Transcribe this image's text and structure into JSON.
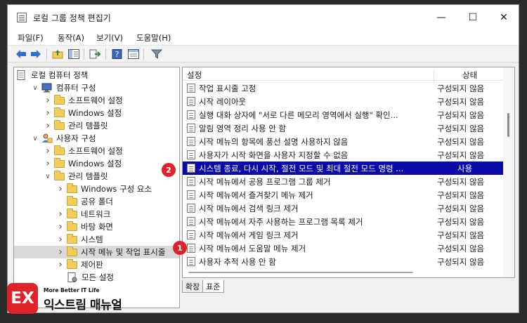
{
  "window": {
    "title": "로컬 그룹 정책 편집기",
    "minimize_glyph": "—",
    "maximize_glyph": "☐",
    "close_glyph": "✕"
  },
  "menubar": [
    "파일(F)",
    "동작(A)",
    "보기(V)",
    "도움말(H)"
  ],
  "toolbar": {
    "icons": [
      "back-arrow-icon",
      "forward-arrow-icon",
      "up-folder-icon",
      "show-hide-tree-icon",
      "export-list-icon",
      "help-icon",
      "properties-icon",
      "filter-icon"
    ]
  },
  "tree": [
    {
      "label": "로컬 컴퓨터 정책",
      "depth": 0,
      "chevron": "",
      "icon": "policy-doc-icon"
    },
    {
      "label": "컴퓨터 구성",
      "depth": 1,
      "chevron": "v",
      "icon": "computer-icon"
    },
    {
      "label": "소프트웨어 설정",
      "depth": 2,
      "chevron": ">",
      "icon": "folder-icon"
    },
    {
      "label": "Windows 설정",
      "depth": 2,
      "chevron": ">",
      "icon": "folder-icon"
    },
    {
      "label": "관리 템플릿",
      "depth": 2,
      "chevron": ">",
      "icon": "folder-icon"
    },
    {
      "label": "사용자 구성",
      "depth": 1,
      "chevron": "v",
      "icon": "user-icon"
    },
    {
      "label": "소프트웨어 설정",
      "depth": 2,
      "chevron": ">",
      "icon": "folder-icon"
    },
    {
      "label": "Windows 설정",
      "depth": 2,
      "chevron": ">",
      "icon": "folder-icon"
    },
    {
      "label": "관리 템플릿",
      "depth": 2,
      "chevron": "v",
      "icon": "folder-icon"
    },
    {
      "label": "Windows 구성 요소",
      "depth": 3,
      "chevron": ">",
      "icon": "folder-icon"
    },
    {
      "label": "공유 폴더",
      "depth": 3,
      "chevron": "",
      "icon": "folder-icon"
    },
    {
      "label": "네트워크",
      "depth": 3,
      "chevron": ">",
      "icon": "folder-icon"
    },
    {
      "label": "바탕 화면",
      "depth": 3,
      "chevron": ">",
      "icon": "folder-icon"
    },
    {
      "label": "시스템",
      "depth": 3,
      "chevron": ">",
      "icon": "folder-icon"
    },
    {
      "label": "시작 메뉴 및 작업 표시줄",
      "depth": 3,
      "chevron": ">",
      "icon": "folder-icon",
      "selected": true
    },
    {
      "label": "제어판",
      "depth": 3,
      "chevron": ">",
      "icon": "folder-icon"
    },
    {
      "label": "모든 설정",
      "depth": 3,
      "chevron": "",
      "icon": "all-settings-icon"
    }
  ],
  "list": {
    "col_setting": "설정",
    "col_state": "상태",
    "rows": [
      {
        "name": "작업 표시줄 고정",
        "state": "구성되지 않음"
      },
      {
        "name": "시작 레이아웃",
        "state": "구성되지 않음"
      },
      {
        "name": "실행 대화 상자에 \"서로 다른 메모리 영역에서 실행\" 확인...",
        "state": "구성되지 않음"
      },
      {
        "name": "알림 영역 정리 사용 안 함",
        "state": "구성되지 않음"
      },
      {
        "name": "시작 메뉴의 항목에 풍선 설명 사용하지 않음",
        "state": "구성되지 않음"
      },
      {
        "name": "사용자가 시작 화면을 사용자 지정할 수 없음",
        "state": "구성되지 않음"
      },
      {
        "name": "시스템 종료, 다시 시작, 절전 모드 및 최대 절전 모드 명령 ...",
        "state": "사용",
        "selected": true
      },
      {
        "name": "시작 메뉴에서 공용 프로그램 그룹 제거",
        "state": "구성되지 않음"
      },
      {
        "name": "시작 메뉴에서 즐겨찾기 메뉴 제거",
        "state": "구성되지 않음"
      },
      {
        "name": "시작 메뉴에서 검색 링크 제거",
        "state": "구성되지 않음"
      },
      {
        "name": "시작 메뉴에서 자주 사용하는 프로그램 목록 제거",
        "state": "구성되지 않음"
      },
      {
        "name": "시작 메뉴에서 게임 링크 제거",
        "state": "구성되지 않음"
      },
      {
        "name": "시작 메뉴에서 도움말 메뉴 제거",
        "state": "구성되지 않음"
      },
      {
        "name": "사용자 추적 사용 안 함",
        "state": "구성되지 않음"
      }
    ]
  },
  "tabs": [
    "확장",
    "표준"
  ],
  "badges": [
    "1",
    "2"
  ],
  "logo": {
    "mark": "EX",
    "tagline": "More Better IT Life",
    "name": "익스트림 매뉴얼"
  },
  "colors": {
    "selection": "#0a0aa8",
    "badge": "#e0232b",
    "folder": "#f4cc58"
  }
}
